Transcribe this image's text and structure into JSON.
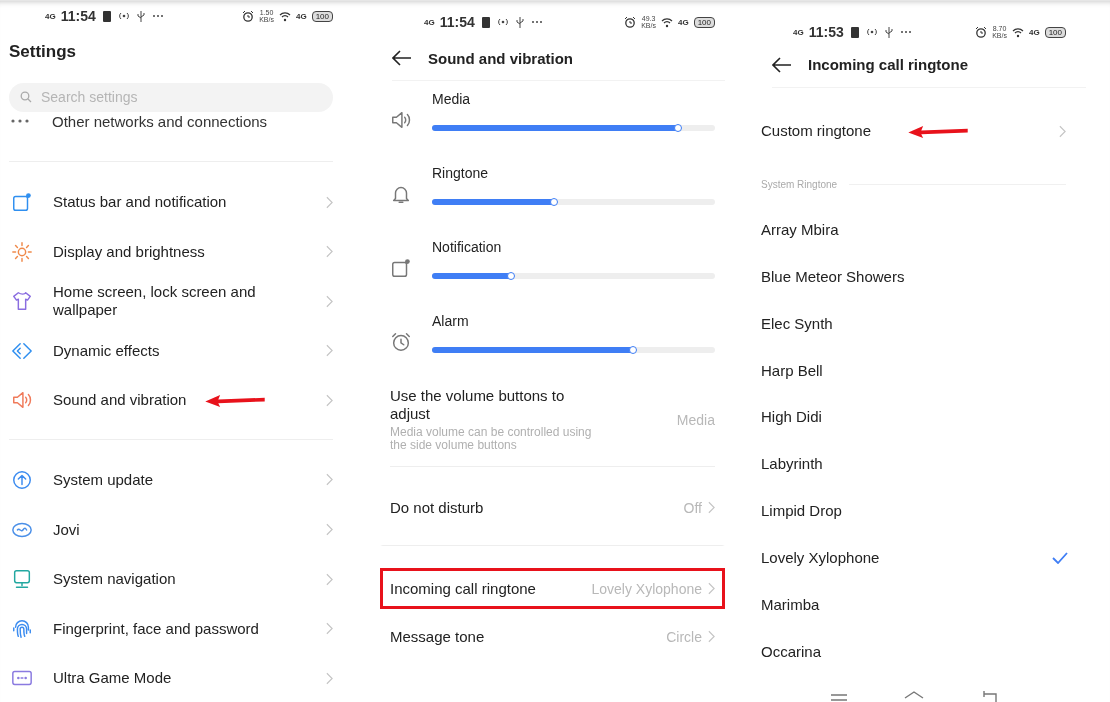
{
  "settings_screen": {
    "status_bar": {
      "network": "4G",
      "time": "11:54",
      "speed": "1.50",
      "speed_unit": "KB/s",
      "data_network": "4G",
      "battery": "100"
    },
    "title": "Settings",
    "search": {
      "placeholder": "Search settings"
    },
    "partial_item": {
      "label": "Other networks and connections"
    },
    "groups": [
      {
        "items": [
          {
            "kind": "notification",
            "color": "#2f8ff0",
            "label": "Status bar and notification",
            "marked": false
          },
          {
            "kind": "sun",
            "color": "#f08a4b",
            "label": "Display and brightness",
            "marked": false
          },
          {
            "kind": "shirt",
            "color": "#8a6de0",
            "label": "Home screen, lock screen and wallpaper",
            "marked": false
          },
          {
            "kind": "chevrons",
            "color": "#2f8ff0",
            "label": "Dynamic effects",
            "marked": false
          },
          {
            "kind": "speaker",
            "color": "#f07a5a",
            "label": "Sound and vibration",
            "marked": true
          }
        ]
      },
      {
        "items": [
          {
            "kind": "update",
            "color": "#3c8cf0",
            "label": "System update",
            "marked": false
          },
          {
            "kind": "oval",
            "color": "#4a8fe8",
            "label": "Jovi",
            "marked": false
          },
          {
            "kind": "monitor",
            "color": "#22a7a0",
            "label": "System navigation",
            "marked": false
          },
          {
            "kind": "fingerprint",
            "color": "#3c8cf0",
            "label": "Fingerprint, face and password",
            "marked": false
          },
          {
            "kind": "game",
            "color": "#8a7ae0",
            "label": "Ultra Game Mode",
            "marked": false
          }
        ]
      }
    ]
  },
  "sound_screen": {
    "status_bar": {
      "network": "4G",
      "time": "11:54",
      "speed": "49.3",
      "speed_unit": "KB/s",
      "data_network": "4G",
      "battery": "100"
    },
    "title": "Sound and vibration",
    "sliders": [
      {
        "kind": "speaker",
        "label": "Media",
        "level": 0.87
      },
      {
        "kind": "bell",
        "label": "Ringtone",
        "level": 0.43
      },
      {
        "kind": "notification",
        "label": "Notification",
        "level": 0.28
      },
      {
        "kind": "alarm",
        "label": "Alarm",
        "level": 0.71
      }
    ],
    "volume_buttons": {
      "title": "Use the volume buttons to adjust",
      "description": "Media volume can be controlled using the side volume buttons",
      "value": "Media"
    },
    "rows": [
      {
        "label": "Do not disturb",
        "value": "Off",
        "highlighted": false
      },
      {
        "label": "Incoming call ringtone",
        "value": "Lovely Xylophone",
        "highlighted": true
      },
      {
        "label": "Message tone",
        "value": "Circle",
        "highlighted": false
      }
    ]
  },
  "ringtone_screen": {
    "status_bar": {
      "network": "4G",
      "time": "11:53",
      "speed": "8.70",
      "speed_unit": "KB/s",
      "data_network": "4G",
      "battery": "100"
    },
    "title": "Incoming call ringtone",
    "custom": {
      "label": "Custom ringtone",
      "marked": true
    },
    "section_label": "System Ringtone",
    "ringtones": [
      {
        "label": "Array Mbira",
        "selected": false
      },
      {
        "label": "Blue Meteor Showers",
        "selected": false
      },
      {
        "label": "Elec Synth",
        "selected": false
      },
      {
        "label": "Harp Bell",
        "selected": false
      },
      {
        "label": "High Didi",
        "selected": false
      },
      {
        "label": "Labyrinth",
        "selected": false
      },
      {
        "label": "Limpid Drop",
        "selected": false
      },
      {
        "label": "Lovely Xylophone",
        "selected": true
      },
      {
        "label": "Marimba",
        "selected": false
      },
      {
        "label": "Occarina",
        "selected": false
      }
    ]
  }
}
